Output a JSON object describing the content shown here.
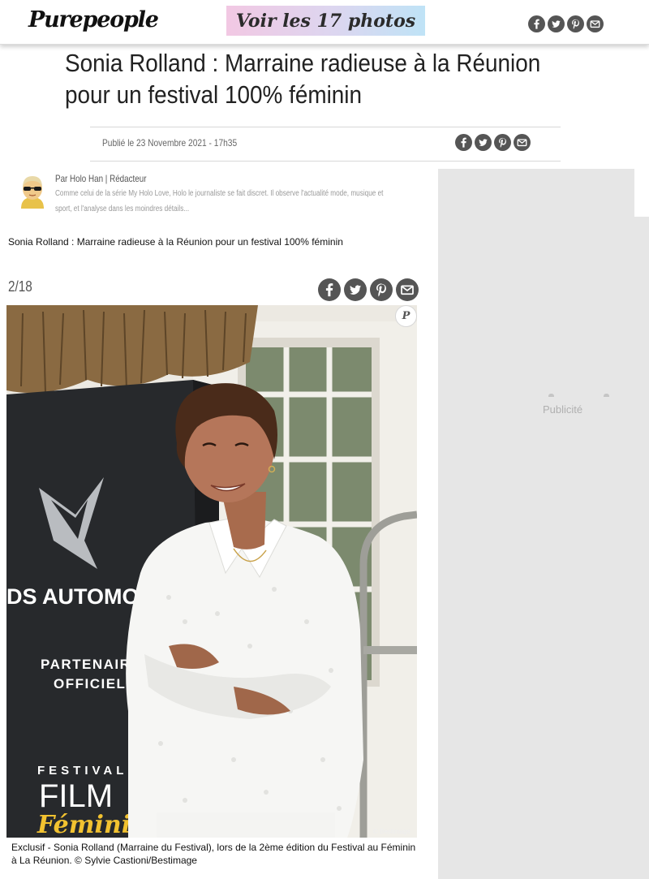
{
  "header": {
    "logo": "Purepeople",
    "photos_button": "Voir les 17 photos"
  },
  "share_icons": [
    "facebook-icon",
    "twitter-icon",
    "pinterest-icon",
    "email-icon"
  ],
  "article": {
    "title": "Sonia Rolland : Marraine radieuse à la Réunion pour un festival 100% féminin",
    "published": "Publié le 23 Novembre 2021 - 17h35",
    "author_line": "Par Holo Han  | Rédacteur",
    "author_bio": "Comme celui de la série My Holo Love, Holo le journaliste se fait discret. Il observe l'actualité mode, musique et sport, et l'analyse dans les moindres détails..."
  },
  "gallery": {
    "title": "Sonia Rolland : Marraine radieuse à la Réunion pour un festival 100% féminin",
    "counter": "2/18",
    "badge": "P",
    "photo_texts": {
      "brand": "DS AUTOMOBILES",
      "partner_1": "PARTENAIRE",
      "partner_2": "OFFICIEL",
      "festival": "FESTIVAL",
      "film": "FILM",
      "feminin": "Féminin"
    },
    "photo_credit_mark": "© Bestimage",
    "caption": "Exclusif - Sonia Rolland (Marraine du Festival), lors de la 2ème édition du Festival au Féminin à La Réunion. © Sylvie Castioni/Bestimage"
  },
  "ad": {
    "label": "Publicité"
  },
  "colors": {
    "icon_gray": "#555555",
    "ad_background": "#e6e6e6",
    "button_gradient": [
      "#f2c8e3",
      "#bfe3f6"
    ]
  }
}
